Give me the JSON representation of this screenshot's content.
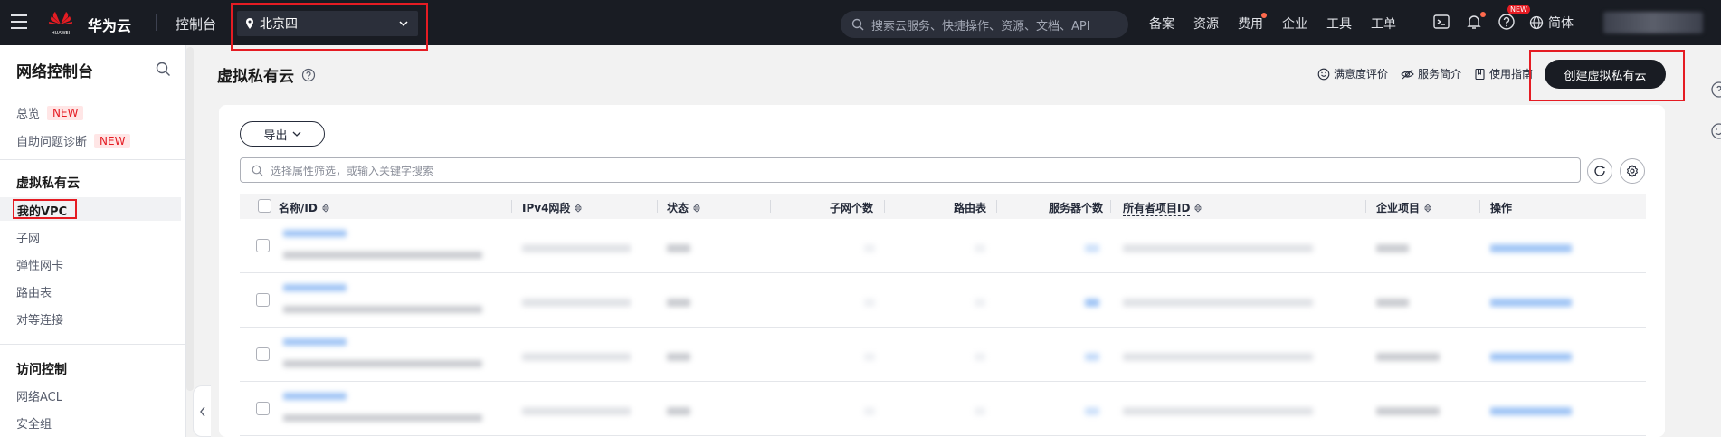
{
  "topnav": {
    "brand": "华为云",
    "logo_text": "HUAWEI",
    "console": "控制台",
    "region": "北京四",
    "search_placeholder": "搜索云服务、快捷操作、资源、文档、API",
    "links": [
      "备案",
      "资源",
      "费用",
      "企业",
      "工具",
      "工单"
    ],
    "new_badge": "NEW",
    "language": "简体"
  },
  "sidebar": {
    "title": "网络控制台",
    "overview": "总览",
    "overview_badge": "NEW",
    "diagnose": "自助问题诊断",
    "diagnose_badge": "NEW",
    "group_vpc": "虚拟私有云",
    "items_vpc": [
      "我的VPC",
      "子网",
      "弹性网卡",
      "路由表",
      "对等连接"
    ],
    "group_access": "访问控制",
    "items_access": [
      "网络ACL",
      "安全组"
    ]
  },
  "header": {
    "title": "虚拟私有云",
    "satisfaction": "满意度评价",
    "service_intro": "服务简介",
    "guide": "使用指南",
    "create_button": "创建虚拟私有云"
  },
  "toolbar": {
    "export": "导出",
    "filter_placeholder": "选择属性筛选，或输入关键字搜索"
  },
  "table": {
    "columns": [
      "名称/ID",
      "IPv4网段",
      "状态",
      "子网个数",
      "路由表",
      "服务器个数",
      "所有者项目ID",
      "企业项目",
      "操作"
    ],
    "row_count": 4
  },
  "colors": {
    "topnav_bg": "#191c23",
    "highlight": "#e51c23",
    "primary_button": "#191c23",
    "new_badge": "#e51c23",
    "link": "#526ecc"
  }
}
